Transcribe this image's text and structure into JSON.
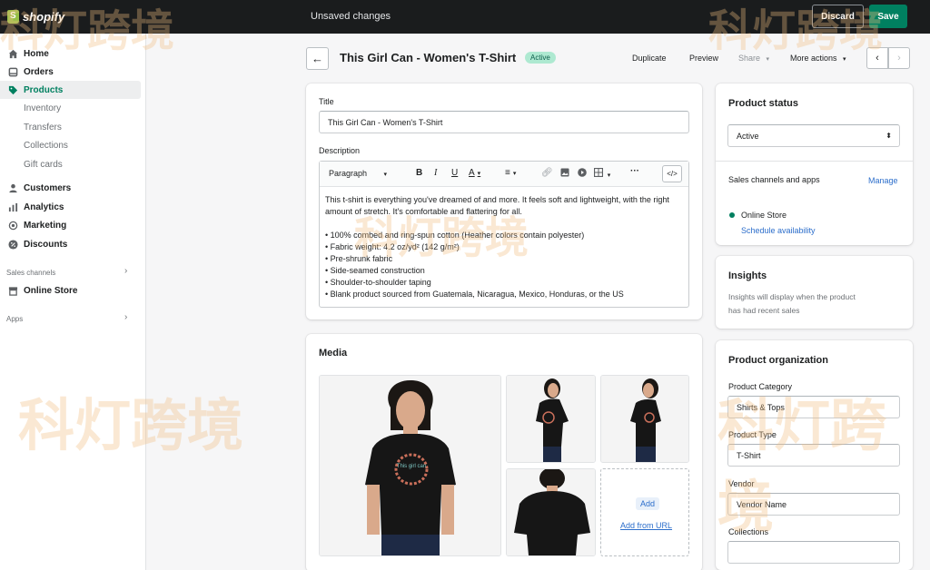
{
  "topbar": {
    "logo_text": "shopify",
    "unsaved_text": "Unsaved changes",
    "discard_label": "Discard",
    "save_label": "Save"
  },
  "sidebar": {
    "items": [
      {
        "label": "Home",
        "icon": "home-icon"
      },
      {
        "label": "Orders",
        "icon": "orders-icon"
      },
      {
        "label": "Products",
        "icon": "tag-icon"
      },
      {
        "label": "Customers",
        "icon": "person-icon"
      },
      {
        "label": "Analytics",
        "icon": "bar-chart-icon"
      },
      {
        "label": "Marketing",
        "icon": "target-icon"
      },
      {
        "label": "Discounts",
        "icon": "discount-icon"
      }
    ],
    "product_subitems": [
      "Inventory",
      "Transfers",
      "Collections",
      "Gift cards"
    ],
    "sales_channels_label": "Sales channels",
    "online_store_label": "Online Store",
    "apps_label": "Apps"
  },
  "header": {
    "title": "This Girl Can - Women's T-Shirt",
    "status_badge": "Active",
    "actions": {
      "duplicate": "Duplicate",
      "preview": "Preview",
      "share": "Share",
      "more_actions": "More actions"
    }
  },
  "details": {
    "title_label": "Title",
    "title_value": "This Girl Can - Women's T-Shirt",
    "description_label": "Description",
    "toolbar": {
      "paragraph": "Paragraph"
    },
    "description_paragraph": "This t-shirt is everything you've dreamed of and more. It feels soft and lightweight, with the right amount of stretch. It's comfortable and flattering for all.",
    "bullets": [
      "• 100% combed and ring-spun cotton (Heather colors contain polyester)",
      "• Fabric weight: 4.2 oz/yd² (142 g/m²)",
      "• Pre-shrunk fabric",
      "• Side-seamed construction",
      "• Shoulder-to-shoulder taping",
      "• Blank product sourced from Guatemala, Nicaragua, Mexico, Honduras, or the US"
    ]
  },
  "media": {
    "title": "Media",
    "tee_text": "This girl can",
    "add_label": "Add",
    "add_from_url": "Add from URL"
  },
  "product_status": {
    "title": "Product status",
    "select_value": "Active",
    "channels_label": "Sales channels and apps",
    "manage_label": "Manage",
    "online_store": "Online Store",
    "schedule": "Schedule availability"
  },
  "insights": {
    "title": "Insights",
    "text_line1": "Insights will display when the product",
    "text_line2": "has had recent sales"
  },
  "organization": {
    "title": "Product organization",
    "category_label": "Product Category",
    "category_value": "Shirts & Tops",
    "type_label": "Product Type",
    "type_value": "T-Shirt",
    "vendor_label": "Vendor",
    "vendor_placeholder": "Vendor Name",
    "collections_label": "Collections"
  },
  "watermark": {
    "text": "科灯跨境"
  },
  "colors": {
    "accent": "#008060",
    "topbar": "#1a1c1d",
    "link": "#2c6ecb",
    "badge_bg": "#aee9d1"
  }
}
